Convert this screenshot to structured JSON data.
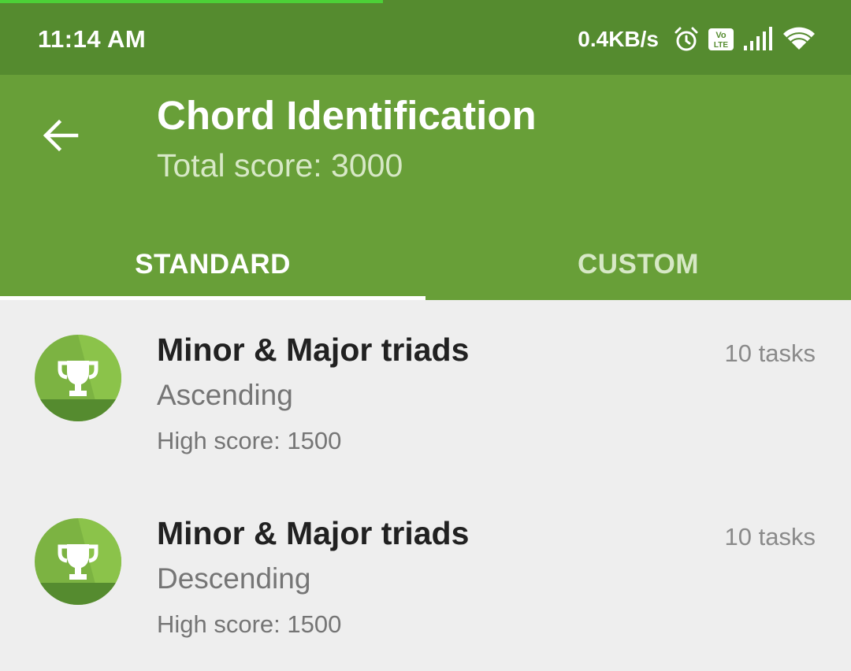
{
  "status_bar": {
    "time": "11:14 AM",
    "net_speed": "0.4KB/s",
    "icons": [
      "alarm-icon",
      "volte-icon",
      "signal-icon",
      "wifi-icon"
    ]
  },
  "app_bar": {
    "back_icon": "arrow-left-icon",
    "title": "Chord Identification",
    "subtitle": "Total score: 3000",
    "color": "#689f38",
    "status_color": "#558b2f"
  },
  "tabs": [
    {
      "label": "STANDARD",
      "selected": true
    },
    {
      "label": "CUSTOM",
      "selected": false
    }
  ],
  "exercises": [
    {
      "icon": "trophy-icon",
      "title": "Minor & Major triads",
      "mode": "Ascending",
      "high_score": "High score: 1500",
      "tasks": "10 tasks"
    },
    {
      "icon": "trophy-icon",
      "title": "Minor & Major triads",
      "mode": "Descending",
      "high_score": "High score: 1500",
      "tasks": "10 tasks"
    }
  ]
}
